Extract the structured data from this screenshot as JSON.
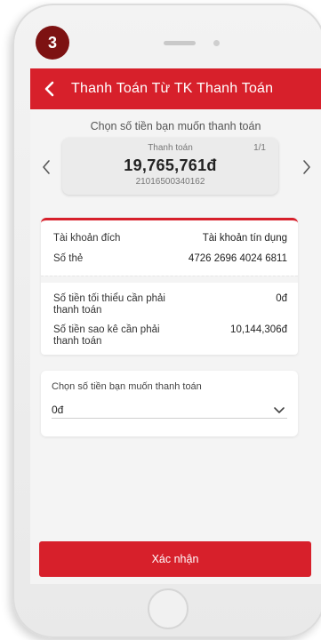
{
  "step_badge": "3",
  "header": {
    "title": "Thanh Toán Từ TK Thanh Toán"
  },
  "subtitle": "Chọn số tiền bạn muốn thanh toán",
  "payment_card": {
    "label": "Thanh toán",
    "page": "1/1",
    "amount": "19,765,761đ",
    "account_number": "21016500340162"
  },
  "info": {
    "dest_account_label": "Tài khoản đích",
    "dest_account_value": "Tài khoản tín dụng",
    "card_number_label": "Số thẻ",
    "card_number_value": "4726 2696 4024 6811",
    "min_due_label": "Số tiền tối thiểu cần phải thanh toán",
    "min_due_value": "0đ",
    "statement_label": "Số tiền sao kê cần phải thanh toán",
    "statement_value": "10,144,306đ"
  },
  "amount_select": {
    "label": "Chọn số tiền bạn muốn thanh toán",
    "value": "0đ"
  },
  "confirm_label": "Xác nhận",
  "colors": {
    "brand_red": "#d7202b",
    "badge": "#7d1212"
  },
  "icons": [
    "back-arrow-icon",
    "chevron-left-icon",
    "chevron-right-icon",
    "chevron-down-icon"
  ]
}
